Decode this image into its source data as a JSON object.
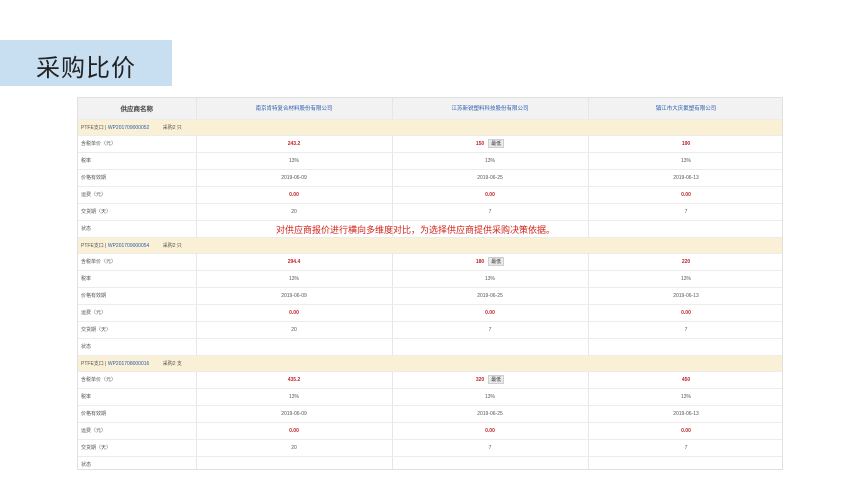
{
  "page": {
    "title": "采购比价",
    "note": "对供应商报价进行横向多维度对比，为选择供应商提供采购决策依据。"
  },
  "header": {
    "col_label": "供应商名称",
    "suppliers": [
      "南京肯特复合材料股份有限公司",
      "江苏新锐塑料科技股份有限公司",
      "镇江市大庆氟塑有限公司"
    ]
  },
  "groups": [
    {
      "product": {
        "name": "PTFE支口",
        "sep": "|",
        "code": "WP201709000052",
        "qty": "采购2 只"
      },
      "rows": [
        {
          "label": "含税单价（元）",
          "values": [
            "243.2",
            "150",
            "190"
          ],
          "style": "red",
          "low_index": 1,
          "low_label": "最低"
        },
        {
          "label": "税率",
          "values": [
            "13%",
            "13%",
            "13%"
          ]
        },
        {
          "label": "价格有效期",
          "values": [
            "2019-06-09",
            "2019-06-25",
            "2019-06-13"
          ]
        },
        {
          "label": "运费（元）",
          "values": [
            "0.00",
            "0.00",
            "0.00"
          ],
          "style": "red"
        },
        {
          "label": "交货期（天）",
          "values": [
            "20",
            "7",
            "7"
          ]
        },
        {
          "label": "状态",
          "values": [
            "",
            "",
            ""
          ]
        }
      ]
    },
    {
      "product": {
        "name": "PTFE支口",
        "sep": "|",
        "code": "WP201709000054",
        "qty": "采购2 只"
      },
      "rows": [
        {
          "label": "含税单价（元）",
          "values": [
            "294.4",
            "180",
            "220"
          ],
          "style": "red",
          "low_index": 1,
          "low_label": "最低"
        },
        {
          "label": "税率",
          "values": [
            "13%",
            "13%",
            "13%"
          ]
        },
        {
          "label": "价格有效期",
          "values": [
            "2019-06-09",
            "2019-06-25",
            "2019-06-13"
          ]
        },
        {
          "label": "运费（元）",
          "values": [
            "0.00",
            "0.00",
            "0.00"
          ],
          "style": "red"
        },
        {
          "label": "交货期（天）",
          "values": [
            "20",
            "7",
            "7"
          ]
        },
        {
          "label": "状态",
          "values": [
            "",
            "",
            ""
          ]
        }
      ]
    },
    {
      "product": {
        "name": "PTFE支口",
        "sep": "|",
        "code": "WP201708000016",
        "qty": "采购2 支"
      },
      "rows": [
        {
          "label": "含税单价（元）",
          "values": [
            "435.2",
            "320",
            "450"
          ],
          "style": "red",
          "low_index": 1,
          "low_label": "最低"
        },
        {
          "label": "税率",
          "values": [
            "13%",
            "13%",
            "13%"
          ]
        },
        {
          "label": "价格有效期",
          "values": [
            "2019-06-09",
            "2019-06-25",
            "2019-06-13"
          ]
        },
        {
          "label": "运费（元）",
          "values": [
            "0.00",
            "0.00",
            "0.00"
          ],
          "style": "red"
        },
        {
          "label": "交货期（天）",
          "values": [
            "20",
            "7",
            "7"
          ]
        },
        {
          "label": "状态",
          "values": [
            "",
            "",
            ""
          ]
        }
      ]
    }
  ]
}
